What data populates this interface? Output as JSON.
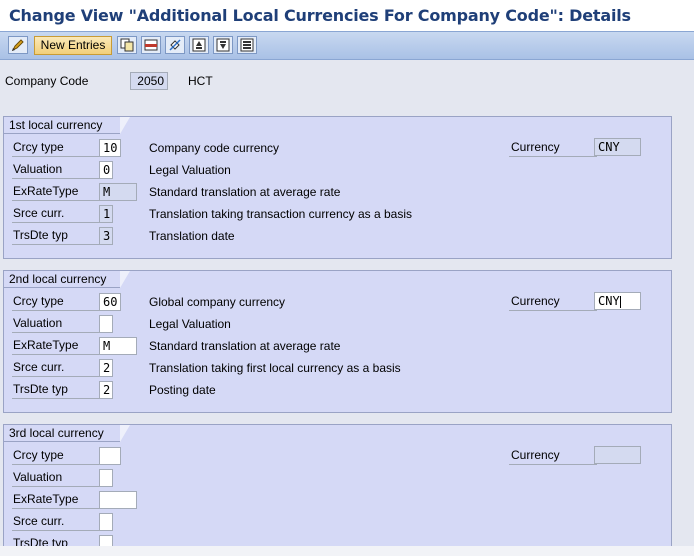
{
  "title": "Change View \"Additional Local Currencies For Company Code\": Details",
  "toolbar": {
    "new_entries": "New Entries"
  },
  "company": {
    "label": "Company Code",
    "code": "2050",
    "name": "HCT"
  },
  "groups": [
    {
      "title": "1st local currency",
      "currency_label": "Currency",
      "currency": "CNY",
      "rows": [
        {
          "label": "Crcy type",
          "value": "10",
          "desc": "Company code currency"
        },
        {
          "label": "Valuation",
          "value": "0",
          "desc": "Legal Valuation"
        },
        {
          "label": "ExRateType",
          "value": "M",
          "desc": "Standard translation at average rate"
        },
        {
          "label": "Srce curr.",
          "value": "1",
          "desc": "Translation taking transaction currency as a basis"
        },
        {
          "label": "TrsDte typ",
          "value": "3",
          "desc": "Translation date"
        }
      ]
    },
    {
      "title": "2nd local currency",
      "currency_label": "Currency",
      "currency": "CNY",
      "rows": [
        {
          "label": "Crcy type",
          "value": "60",
          "desc": "Global company currency"
        },
        {
          "label": "Valuation",
          "value": "",
          "desc": "Legal Valuation"
        },
        {
          "label": "ExRateType",
          "value": "M",
          "desc": "Standard translation at average rate"
        },
        {
          "label": "Srce curr.",
          "value": "2",
          "desc": "Translation taking first local currency as a basis"
        },
        {
          "label": "TrsDte typ",
          "value": "2",
          "desc": "Posting date"
        }
      ]
    },
    {
      "title": "3rd local currency",
      "currency_label": "Currency",
      "currency": "",
      "rows": [
        {
          "label": "Crcy type",
          "value": "",
          "desc": ""
        },
        {
          "label": "Valuation",
          "value": "",
          "desc": ""
        },
        {
          "label": "ExRateType",
          "value": "",
          "desc": ""
        },
        {
          "label": "Srce curr.",
          "value": "",
          "desc": ""
        },
        {
          "label": "TrsDte typ",
          "value": "",
          "desc": ""
        }
      ]
    }
  ]
}
